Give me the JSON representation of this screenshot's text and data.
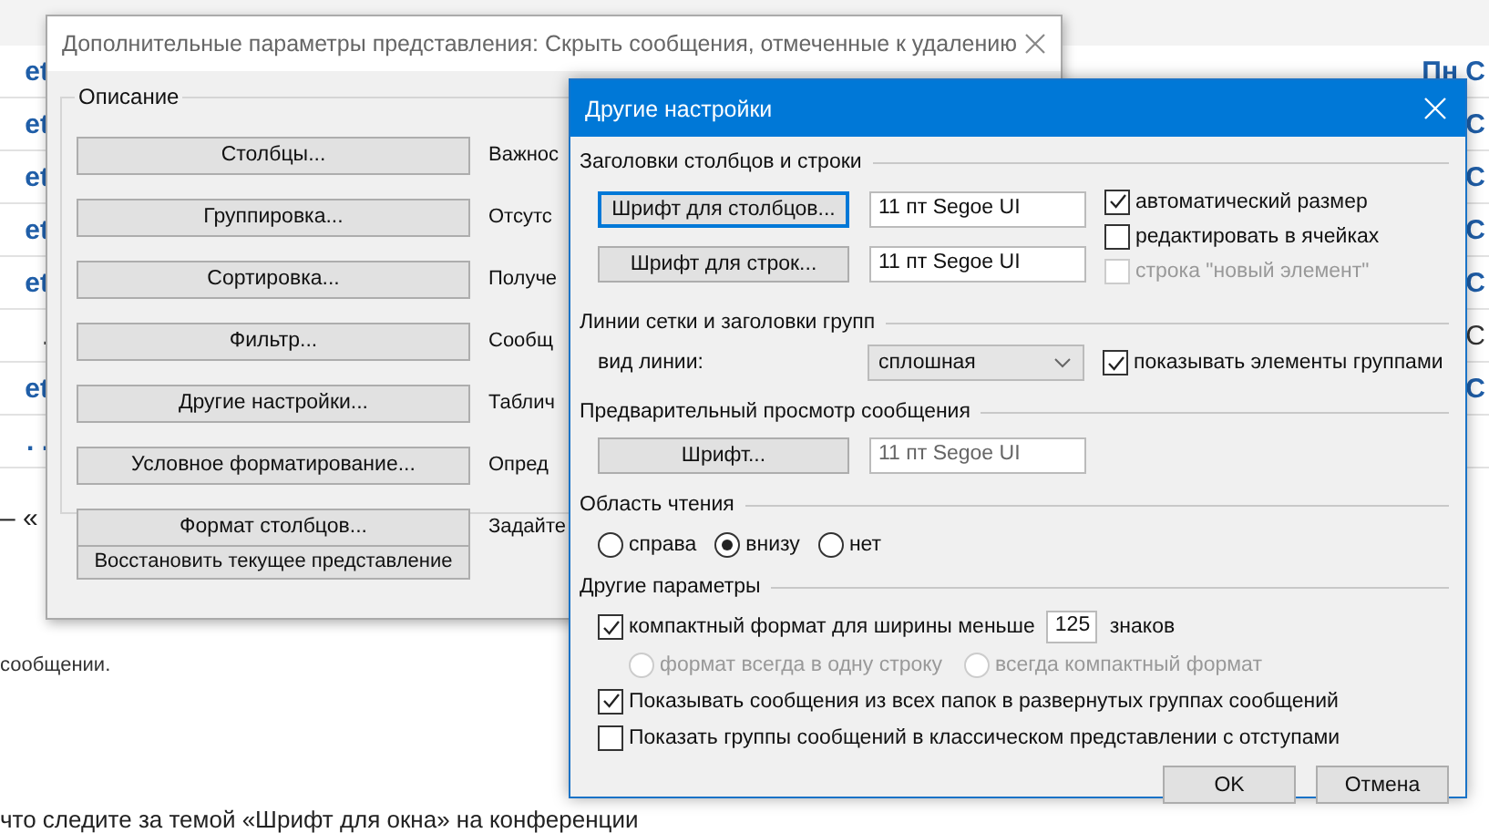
{
  "background": {
    "rows": [
      {
        "left": "et",
        "right": "Пн С",
        "unread": true
      },
      {
        "left": "et",
        "right": "С",
        "unread": true
      },
      {
        "left": "et",
        "right": "С",
        "unread": true
      },
      {
        "left": "et",
        "right": "С",
        "unread": true
      },
      {
        "left": "et",
        "right": "С",
        "unread": true
      },
      {
        "left": ".",
        "right": "С",
        "unread": false
      },
      {
        "left": "et",
        "right": "С",
        "unread": true
      },
      {
        "left": ". .",
        "unread": true
      }
    ],
    "quote_start": "– «",
    "note": "сообщении.",
    "message_line": "что следите за темой «Шрифт для окна» на конференции"
  },
  "view_dialog": {
    "title": "Дополнительные параметры представления: Скрыть сообщения, отмеченные к удалению",
    "group_label": "Описание",
    "settings": [
      {
        "button": "Столбцы...",
        "description": "Важнос"
      },
      {
        "button": "Группировка...",
        "description": "Отсутс"
      },
      {
        "button": "Сортировка...",
        "description": "Получе"
      },
      {
        "button": "Фильтр...",
        "description": "Сообщ"
      },
      {
        "button": "Другие настройки...",
        "description": "Таблич"
      },
      {
        "button": "Условное форматирование...",
        "description": "Опред"
      },
      {
        "button": "Формат столбцов...",
        "description": "Задайте"
      }
    ],
    "reset_button": "Восстановить текущее представление"
  },
  "other_settings": {
    "title": "Другие настройки",
    "headers_section": {
      "label": "Заголовки столбцов и строки",
      "font_rows": [
        {
          "button": "Шрифт для столбцов...",
          "focused": true,
          "value": "11 пт Segoe UI"
        },
        {
          "button": "Шрифт для строк...",
          "focused": false,
          "value": "11 пт Segoe UI"
        }
      ],
      "checkboxes": [
        {
          "label": "автоматический размер",
          "checked": true,
          "disabled": false
        },
        {
          "label": "редактировать в ячейках",
          "checked": false,
          "disabled": false
        },
        {
          "label": "строка \"новый элемент\"",
          "checked": false,
          "disabled": true
        }
      ]
    },
    "grid_section": {
      "label": "Линии сетки и заголовки групп",
      "line_style_label": "вид линии:",
      "line_style": "сплошная",
      "group_checkbox": {
        "label": "показывать элементы группами",
        "checked": true,
        "disabled": false
      }
    },
    "preview_section": {
      "label": "Предварительный просмотр сообщения",
      "button": "Шрифт...",
      "value": "11 пт Segoe UI",
      "disabled": true
    },
    "reading_pane_section": {
      "label": "Область чтения",
      "options": [
        {
          "label": "справа",
          "selected": false
        },
        {
          "label": "внизу",
          "selected": true
        },
        {
          "label": "нет",
          "selected": false
        }
      ]
    },
    "other_section": {
      "label": "Другие параметры",
      "compact": {
        "label": "компактный формат для ширины меньше",
        "checked": true,
        "value": "125",
        "unit": "знаков"
      },
      "compact_options": [
        {
          "label": "формат всегда в одну строку",
          "selected": false,
          "disabled": true
        },
        {
          "label": "всегда компактный формат",
          "selected": false,
          "disabled": true
        }
      ],
      "checkboxes": [
        {
          "label": "Показывать сообщения из всех папок в развернутых группах сообщений",
          "checked": true,
          "disabled": false
        },
        {
          "label": "Показать группы сообщений в классическом представлении с отступами",
          "checked": false,
          "disabled": false
        }
      ]
    },
    "buttons": [
      {
        "label": "OK"
      },
      {
        "label": "Отмена"
      }
    ]
  }
}
